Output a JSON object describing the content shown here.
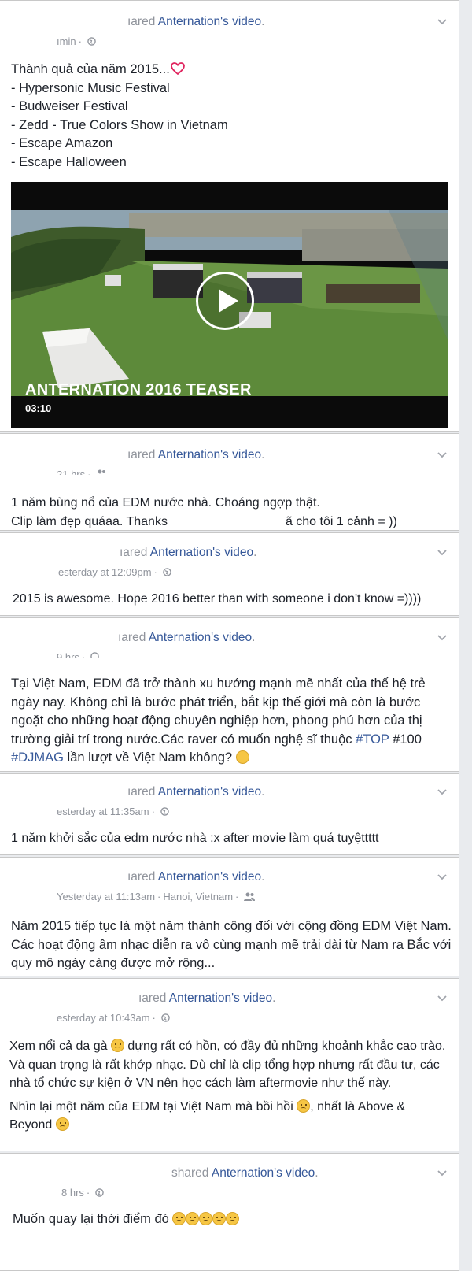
{
  "posts": [
    {
      "header_prefix": "ıared ",
      "page": "Anternation",
      "header_suffix": "'s video",
      "period": ".",
      "time": "ımin",
      "privacy_icon": "globe-icon",
      "lines": [
        "Thành quả của năm 2015...",
        "- Hypersonic Music Festival",
        "- Budweiser Festival",
        "- Zedd - True Colors Show in Vietnam",
        "- Escape Amazon",
        "- Escape Halloween"
      ],
      "heart_icon": "heart-icon",
      "video": {
        "title": "ANTERNATION 2016 TEASER",
        "duration": "03:10"
      }
    },
    {
      "header_prefix": "ıared ",
      "page": "Anternation",
      "header_suffix": "'s video",
      "period": ".",
      "time": "21 hrs",
      "privacy_icon": "friends-icon",
      "line1": "1 năm bùng nổ của EDM nước nhà. Choáng ngợp thật.",
      "line2a": "Clip làm đẹp quáaa. Thanks",
      "line2b": "ã cho tôi 1 cảnh = ))"
    },
    {
      "header_prefix": "ıared ",
      "page": "Anternation",
      "header_suffix": "'s video",
      "period": ".",
      "time": "esterday at 12:09pm",
      "privacy_icon": "globe-icon",
      "text": "2015 is awesome. Hope 2016 better than with someone i don't know =))))"
    },
    {
      "header_prefix": "ıared ",
      "page": "Anternation",
      "header_suffix": "'s video",
      "period": ".",
      "time": "9 hrs",
      "privacy_icon": "globe-icon",
      "text_a": "Tại Việt Nam, EDM đã trở thành xu hướng mạnh mẽ nhất của thế hệ trẻ ngày nay. Không chỉ là bước phát triển, bắt kịp thế giới mà còn là bước ngoặt cho những hoạt động chuyên nghiệp hơn, phong phú hơn của thị trường giải trí trong nước.Các raver có muốn nghệ sĩ thuộc ",
      "tag1": "#TOP",
      "text_b": " #100 ",
      "tag2": "#DJMAG",
      "text_c": " lần lượt về Việt Nam không? ",
      "emoji": "grimace-emoji"
    },
    {
      "header_prefix": "ıared ",
      "page": "Anternation",
      "header_suffix": "'s video",
      "period": ".",
      "time": "esterday at 11:35am",
      "privacy_icon": "globe-icon",
      "text": "1 năm khởi sắc của edm nước nhà :x after movie làm quá tuyệttttt"
    },
    {
      "header_prefix": "ıared ",
      "page": "Anternation",
      "header_suffix": "'s video",
      "period": ".",
      "time": "Yesterday at 11:13am",
      "location": "Hanoi, Vietnam",
      "privacy_icon": "friends-icon",
      "text": "Năm 2015 tiếp tục là một năm thành công đối với cộng đồng EDM Việt Nam. Các hoạt động âm nhạc diễn ra vô cùng mạnh mẽ trải dài từ Nam ra Bắc với quy mô ngày càng được mở rộng..."
    },
    {
      "header_prefix": "ıared ",
      "page": "Anternation",
      "header_suffix": "'s video",
      "period": ".",
      "time": "esterday at 10:43am",
      "privacy_icon": "globe-icon",
      "p1a": "Xem nổi cả da gà ",
      "p1b": " dựng rất có hồn, có đầy đủ những khoảnh khắc cao trào. Và quan trọng là rất khớp nhạc. Dù chỉ là clip tổng hợp nhưng rất đầu tư, các nhà tổ chức sự kiện ở VN nên học cách làm aftermovie như thế này.",
      "p2a": "Nhìn lại một năm của EDM tại Việt Nam mà bồi hồi ",
      "p2b": ", nhất là Above & Beyond ",
      "emoji": "smile-emoji"
    },
    {
      "header_prefix": "shared ",
      "page": "Anternation",
      "header_suffix": "'s video",
      "period": ".",
      "time": "8 hrs",
      "privacy_icon": "globe-icon",
      "text": "Muốn quay lại thời điểm đó ",
      "emoji": "crying-emoji",
      "emoji_count": 5
    }
  ],
  "colors": {
    "link": "#365899",
    "meta": "#90949c",
    "text": "#1d2129",
    "background": "#e9ebee",
    "heart": "#e0245e"
  },
  "menu_icon": "chevron-down-icon"
}
